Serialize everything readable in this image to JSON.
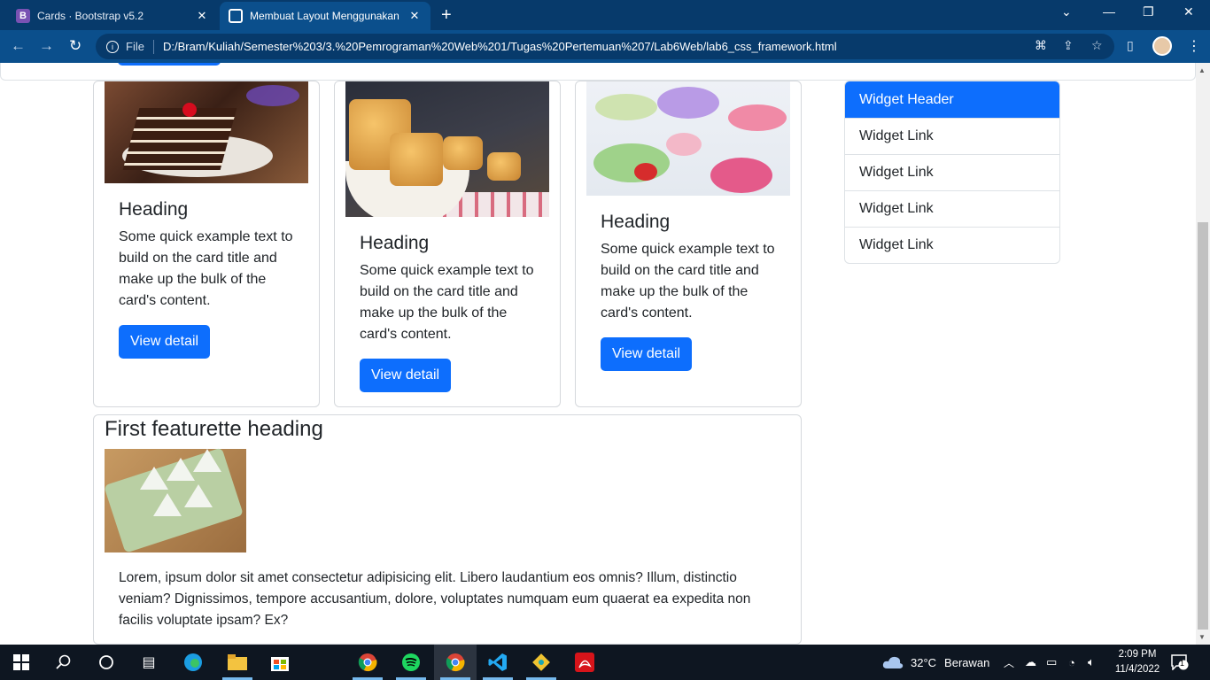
{
  "browser": {
    "tabs": [
      {
        "title": "Cards · Bootstrap v5.2",
        "favicon": "B"
      },
      {
        "title": "Membuat Layout Menggunakan",
        "active": true
      }
    ],
    "address": {
      "scheme_label": "File",
      "url": "D:/Bram/Kuliah/Semester%203/3.%20Pemrograman%20Web%201/Tugas%20Pertemuan%207/Lab6Web/lab6_css_framework.html"
    }
  },
  "cards": [
    {
      "heading": "Heading",
      "text": "Some quick example text to build on the card title and make up the bulk of the card's content.",
      "button": "View detail",
      "image": "chocolate-cake-photo"
    },
    {
      "heading": "Heading",
      "text": "Some quick example text to build on the card title and make up the bulk of the card's content.",
      "button": "View detail",
      "image": "nastar-cookies-photo"
    },
    {
      "heading": "Heading",
      "text": "Some quick example text to build on the card title and make up the bulk of the card's content.",
      "button": "View detail",
      "image": "jelly-cakes-photo"
    }
  ],
  "widget": {
    "header": "Widget Header",
    "links": [
      "Widget Link",
      "Widget Link",
      "Widget Link",
      "Widget Link"
    ]
  },
  "featurette": {
    "heading": "First featurette heading",
    "image": "kue-bugis-photo",
    "text": "Lorem, ipsum dolor sit amet consectetur adipisicing elit. Libero laudantium eos omnis? Illum, distinctio veniam? Dignissimos, tempore accusantium, dolore, voluptates numquam eum quaerat ea expedita non facilis voluptate ipsam? Ex?"
  },
  "taskbar": {
    "weather_temp": "32°C",
    "weather_text": "Berawan",
    "time": "2:09 PM",
    "date": "11/4/2022",
    "notifications": "1"
  },
  "colors": {
    "primary": "#0d6efd",
    "tabbar": "#073a6b",
    "addressbar": "#0b4f8c",
    "taskbar": "#0e1621"
  }
}
